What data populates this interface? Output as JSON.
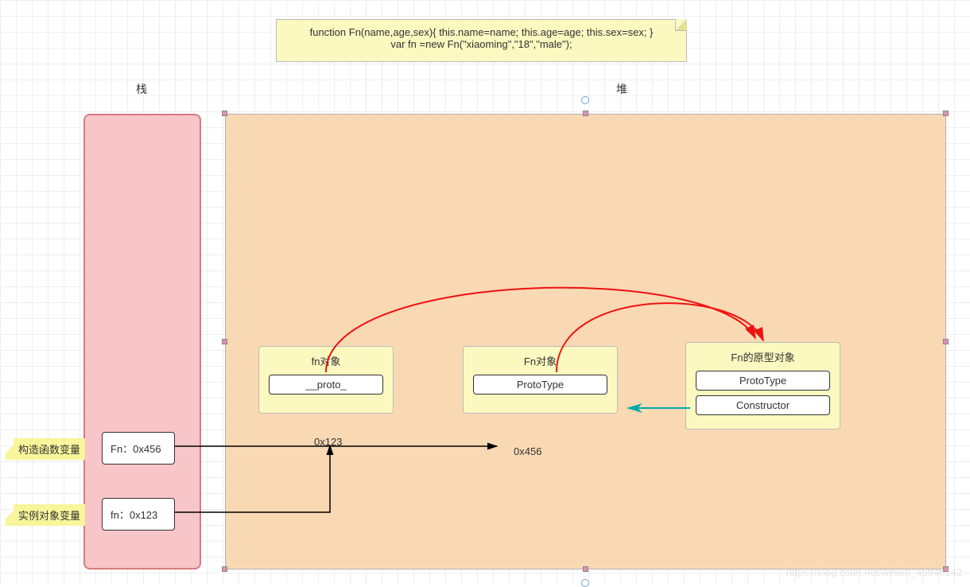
{
  "header": {
    "code_line1": "function Fn(name,age,sex){    this.name=name;    this.age=age;    this.sex=sex;   }",
    "code_line2": "var fn =new Fn(\"xiaoming\",\"18\",\"male\");"
  },
  "labels": {
    "stack": "栈",
    "heap": "堆"
  },
  "side_labels": {
    "constructor_var": "构造函数变量",
    "instance_var": "实例对象变量"
  },
  "stack_vars": {
    "fn_constructor": "Fn：0x456",
    "fn_instance": "fn：0x123"
  },
  "heap_objects": {
    "fn_instance": {
      "title": "fn对象",
      "props": [
        "__proto_"
      ],
      "addr": "0x123"
    },
    "fn_constructor": {
      "title": "Fn对象",
      "props": [
        "ProtoType"
      ],
      "addr": "0x456"
    },
    "fn_prototype": {
      "title": "Fn的原型对象",
      "props": [
        "ProtoType",
        "Constructor"
      ]
    }
  },
  "watermark": "https://blog.csdn.net/weixin_45946142"
}
